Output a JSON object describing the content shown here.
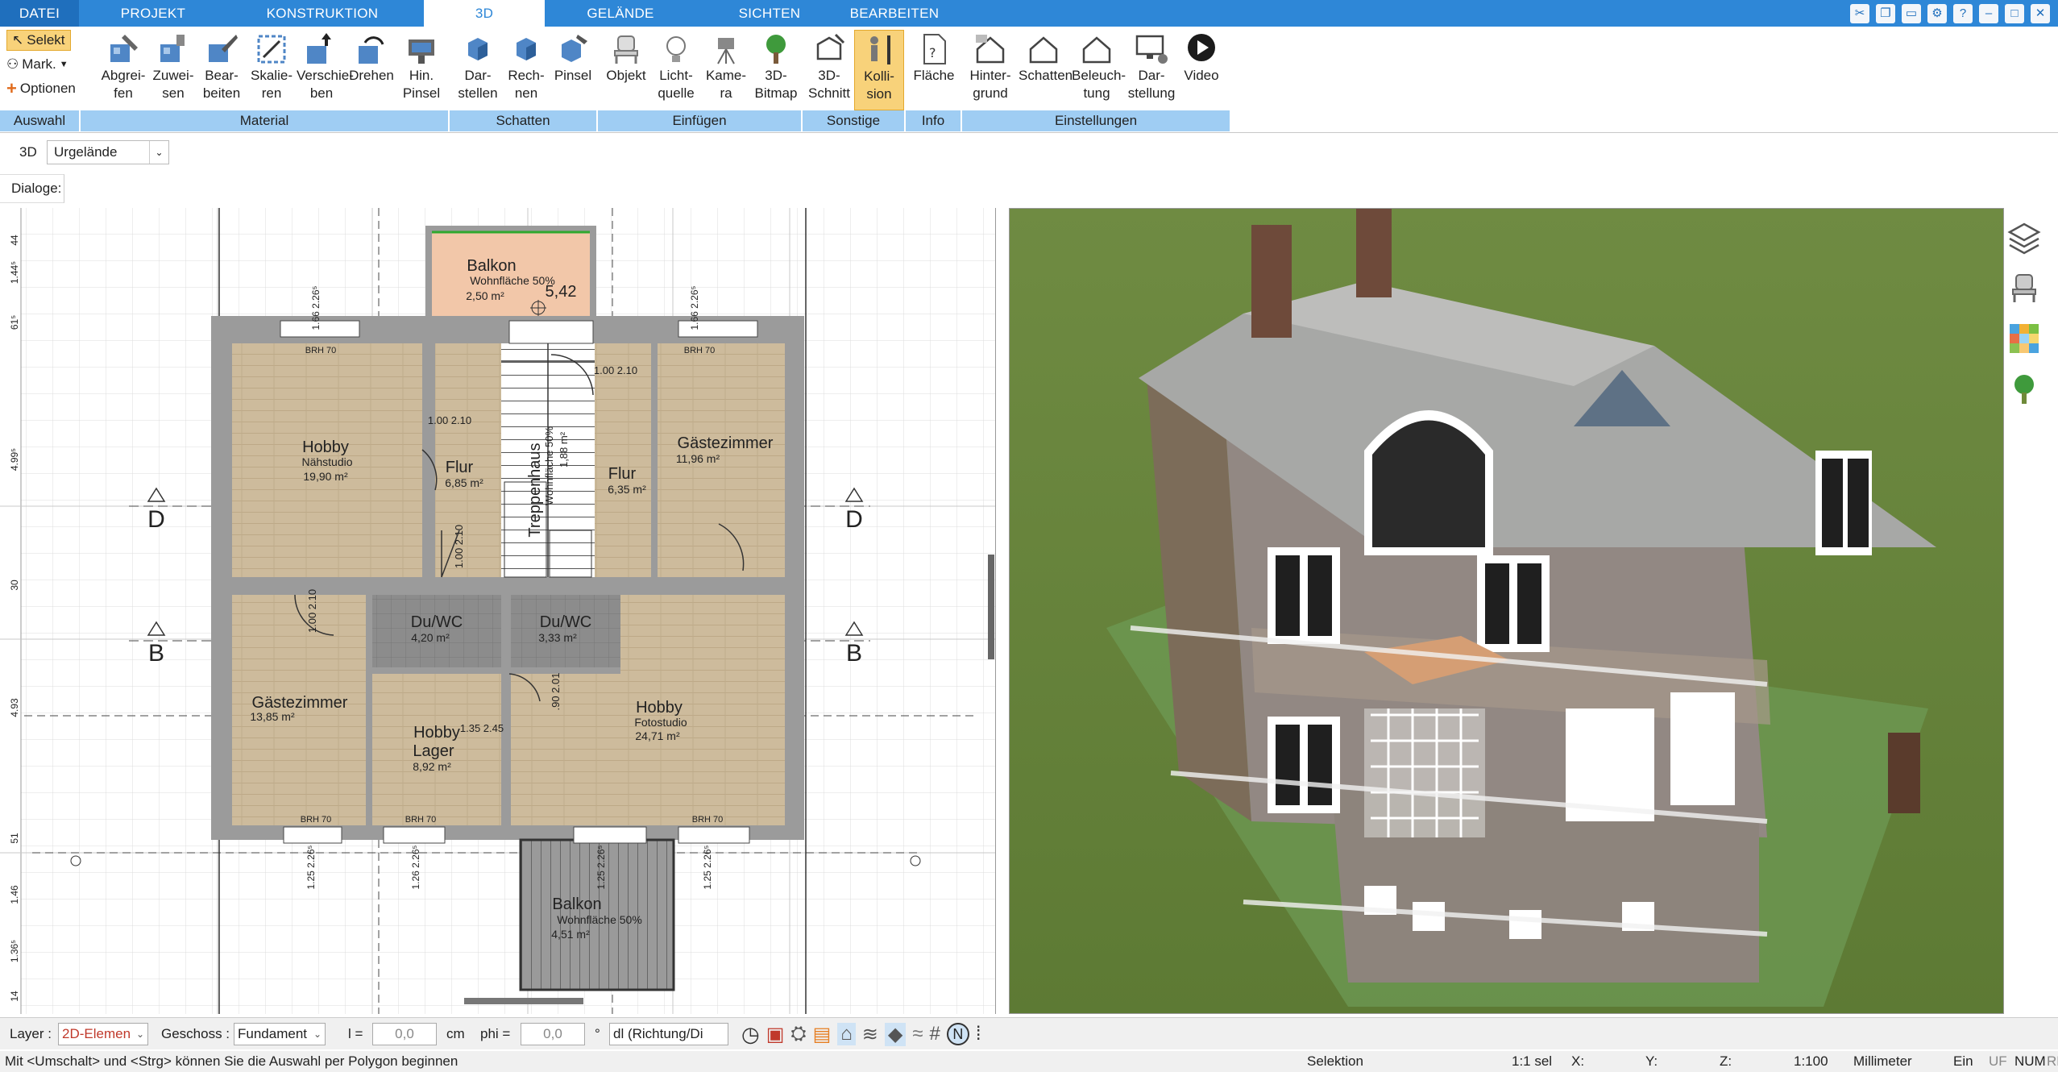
{
  "tabs": {
    "file": "DATEI",
    "project": "PROJEKT",
    "construction": "KONSTRUKTION",
    "threed": "3D",
    "terrain": "GELÄNDE",
    "views": "SICHTEN",
    "edit": "BEARBEITEN"
  },
  "ribbon": {
    "selection": {
      "select": "Selekt",
      "mark": "Mark.",
      "options": "Optionen",
      "label": "Auswahl"
    },
    "material": {
      "label": "Material",
      "pick": "Abgrei-\nfen",
      "assign": "Zuwei-\nsen",
      "edit": "Bear-\nbeiten",
      "scale": "Skalie-\nren",
      "move": "Verschie-\nben",
      "rotate": "Drehen",
      "bg_brush": "Hin.\nPinsel"
    },
    "shadow": {
      "label": "Schatten",
      "display": "Dar-\nstellen",
      "calc": "Rech-\nnen",
      "brush": "Pinsel"
    },
    "insert": {
      "label": "Einfügen",
      "object": "Objekt",
      "light": "Licht-\nquelle",
      "camera": "Kame-\nra",
      "bitmap": "3D-\nBitmap"
    },
    "other": {
      "label": "Sonstige",
      "section": "3D-\nSchnitt",
      "collision": "Kolli-\nsion"
    },
    "info": {
      "label": "Info",
      "area": "Fläche"
    },
    "settings": {
      "label": "Einstellungen",
      "background": "Hinter-\ngrund",
      "shadow": "Schatten",
      "lighting": "Beleuch-\ntung",
      "display": "Dar-\nstellung",
      "video": "Video"
    }
  },
  "view_row": {
    "mode": "3D",
    "terrain_value": "Urgelände"
  },
  "dialog_row": {
    "label": "Dialoge:"
  },
  "plan": {
    "rooms": [
      {
        "name": "Balkon",
        "sub": "Wohnfläche 50%",
        "area": "2,50 m²"
      },
      {
        "name": "Hobby",
        "sub": "Nähstudio",
        "area": "19,90 m²"
      },
      {
        "name": "Flur",
        "sub": "",
        "area": "6,85 m²"
      },
      {
        "name": "Treppenhaus",
        "sub": "Wohnfläche 50%",
        "area": "1,88 m²"
      },
      {
        "name": "Flur",
        "sub": "",
        "area": "6,35 m²"
      },
      {
        "name": "Gästezimmer",
        "sub": "",
        "area": "11,96 m²"
      },
      {
        "name": "Du/WC",
        "sub": "",
        "area": "4,20 m²"
      },
      {
        "name": "Du/WC",
        "sub": "",
        "area": "3,33 m²"
      },
      {
        "name": "Gästezimmer",
        "sub": "",
        "area": "13,85 m²"
      },
      {
        "name": "Hobby",
        "sub": "Lager",
        "area": "8,92 m²"
      },
      {
        "name": "Hobby",
        "sub": "Fotostudio",
        "area": "24,71 m²"
      },
      {
        "name": "Balkon",
        "sub": "Wohnfläche 50%",
        "area": "4,51 m²"
      }
    ],
    "level": "5,42",
    "section_marks": [
      "D",
      "D",
      "B",
      "B"
    ],
    "brh": [
      "BRH 70",
      "BRH 70",
      "BRH 70",
      "BRH 70",
      "BRH 70"
    ],
    "door_dims": [
      "1.00\n2.10",
      "1.00\n2.10",
      "1.00\n2.10",
      "1.00\n2.10",
      "1.35\n2.45",
      ".90\n2.01"
    ],
    "left_ruler": [
      "44",
      "1.44⁵",
      "61⁵",
      "4.99⁵",
      "30",
      "4.93",
      "51",
      "1.46",
      "1.36⁵",
      "14"
    ],
    "top_dims": [
      "1.66\n2.26⁵",
      "1.66\n2.26⁵"
    ],
    "bottom_dims": [
      "1.25\n2.26⁵",
      "1.26\n2.26⁵",
      "1.25\n2.26⁵",
      "1.25\n2.26⁵"
    ]
  },
  "bottom": {
    "layer_label": "Layer :",
    "layer_value": "2D-Elemen",
    "floor_label": "Geschoss :",
    "floor_value": "Fundament",
    "l_label": "l =",
    "l_value": "0,0",
    "unit": "cm",
    "phi_label": "phi =",
    "phi_value": "0,0",
    "deg": "°",
    "dl_value": "dl (Richtung/Di"
  },
  "status": {
    "hint": "Mit <Umschalt> und <Strg> können Sie die Auswahl per Polygon beginnen",
    "mode": "Selektion",
    "scale_sel": "1:1 sel",
    "x": "X:",
    "y": "Y:",
    "z": "Z:",
    "scale": "1:100",
    "unit": "Millimeter",
    "on": "Ein",
    "uf": "UF",
    "num": "NUM",
    "rf": "RF"
  },
  "colors": {
    "accent": "#2e87d7",
    "ribbon_group": "#9fcdf3",
    "active_button": "#f8d27a",
    "floor_wood": "#cbb99a",
    "tile": "#8e8e8e",
    "wall": "#9a9a9a",
    "grass": "#66833d"
  }
}
